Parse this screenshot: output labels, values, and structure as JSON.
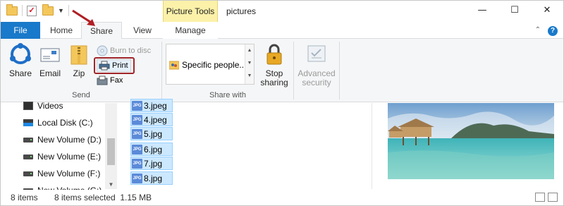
{
  "title_bar": {
    "contextual_header": "Picture Tools",
    "window_title": "pictures",
    "controls": {
      "minimize": "—",
      "maximize": "☐",
      "close": "✕"
    }
  },
  "tabs": {
    "file": "File",
    "home": "Home",
    "share": "Share",
    "view": "View",
    "manage": "Manage"
  },
  "ribbon": {
    "send_group": {
      "label": "Send",
      "share": "Share",
      "email": "Email",
      "zip": "Zip",
      "burn": "Burn to disc",
      "print": "Print",
      "fax": "Fax"
    },
    "share_with_group": {
      "label": "Share with",
      "specific_people": "Specific people...",
      "stop_sharing_line1": "Stop",
      "stop_sharing_line2": "sharing",
      "advanced_security_line1": "Advanced",
      "advanced_security_line2": "security"
    }
  },
  "nav": {
    "items": [
      {
        "label": "Videos",
        "icon": "video-folder-icon"
      },
      {
        "label": "Local Disk (C:)",
        "icon": "windows-drive-icon"
      },
      {
        "label": "New Volume (D:)",
        "icon": "drive-icon"
      },
      {
        "label": "New Volume (E:)",
        "icon": "drive-icon"
      },
      {
        "label": "New Volume (F:)",
        "icon": "drive-icon"
      },
      {
        "label": "New Volume (G:)",
        "icon": "drive-icon"
      }
    ]
  },
  "files": {
    "icon_text": "JPG",
    "items": [
      "3.jpeg",
      "4.jpeg",
      "5.jpg",
      "6.jpg",
      "7.jpg",
      "8.jpg"
    ]
  },
  "status": {
    "items": "8 items",
    "selected": "8 items selected  1.15 MB"
  },
  "colors": {
    "accent": "#1979ca",
    "contextual": "#fbf1a9",
    "highlight_box": "#a0262b",
    "selection": "#cce8ff"
  }
}
